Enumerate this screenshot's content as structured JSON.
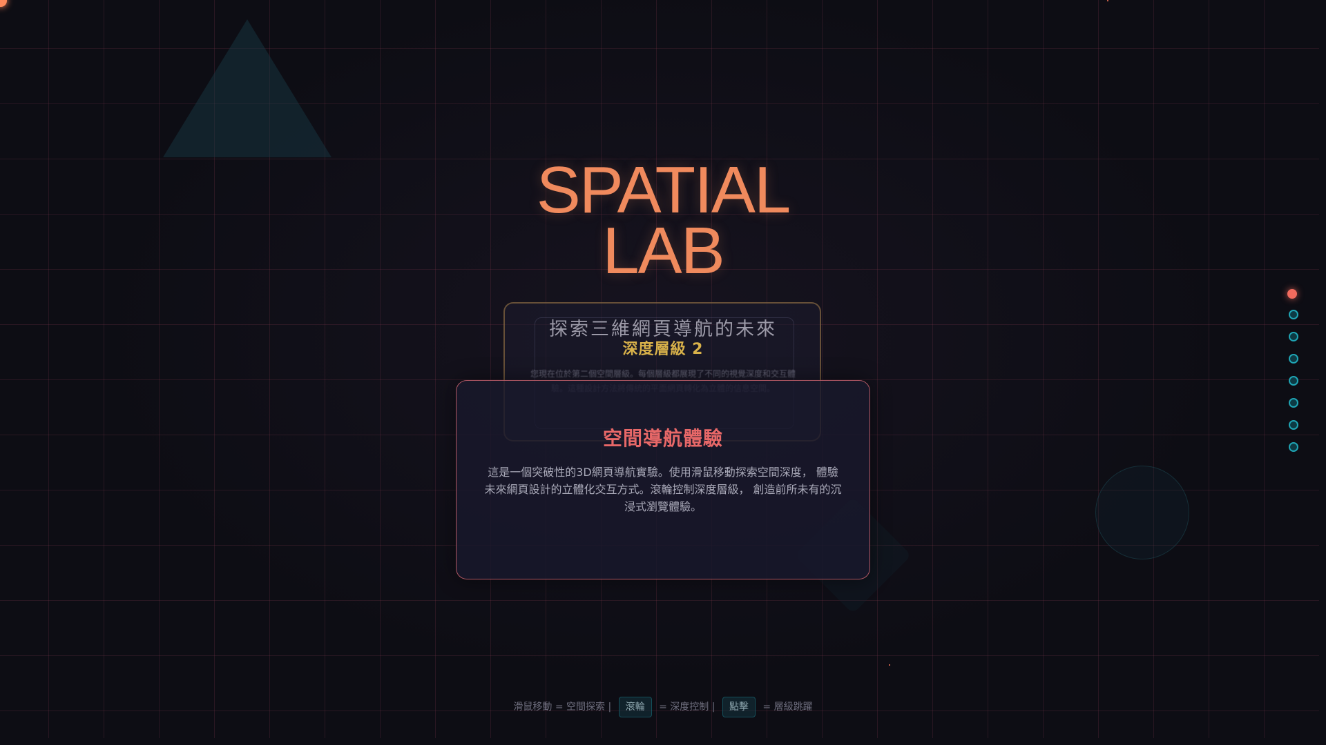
{
  "app": {
    "title_line1": "SPATIAL",
    "title_line2": "LAB",
    "subtitle": "探索三維網頁導航的未來"
  },
  "layers": {
    "back": {
      "title": "深度層級 2",
      "description": "您現在位於第二個空間層級。每個層級都展現了不同的視覺深度和交互體驗。這種設計方法將傳統的平面網頁轉化為立體的信息空間。"
    },
    "front": {
      "title": "空間導航體驗",
      "description": "這是一個突破性的3D網頁導航實驗。使用滑鼠移動探索空間深度， 體驗未來網頁設計的立體化交互方式。滾輪控制深度層級， 創造前所未有的沉浸式瀏覽體驗。"
    }
  },
  "navigation": {
    "dot_count": 8,
    "active_index": 0
  },
  "hint": {
    "part1": "滑鼠移動 = 空間探索 |",
    "key1": "滾輪",
    "part2": "= 深度控制 |",
    "key2": "點擊",
    "part3": "= 層級跳躍"
  },
  "colors": {
    "background": "#0d0d14",
    "title": "#f08a5d",
    "depth_title": "#d9b24a",
    "front_title": "#e86868",
    "nav_active": "#f26b5e",
    "nav_inactive": "#1fa5b5"
  }
}
